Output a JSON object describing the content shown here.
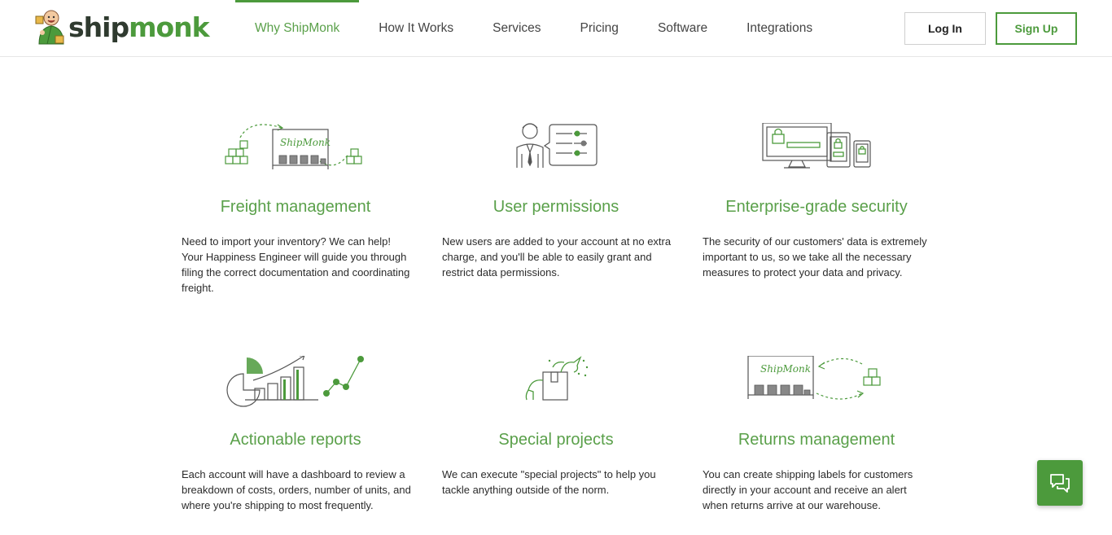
{
  "brand": {
    "name_part1": "ship",
    "name_part2": "monk",
    "accent_color": "#4c9a3c",
    "text_color": "#2f3a2f"
  },
  "nav": {
    "items": [
      {
        "label": "Why ShipMonk",
        "active": true
      },
      {
        "label": "How It Works",
        "active": false
      },
      {
        "label": "Services",
        "active": false
      },
      {
        "label": "Pricing",
        "active": false
      },
      {
        "label": "Software",
        "active": false
      },
      {
        "label": "Integrations",
        "active": false
      }
    ]
  },
  "auth": {
    "login_label": "Log In",
    "signup_label": "Sign Up"
  },
  "features": [
    {
      "icon": "freight-icon",
      "title": "Freight management",
      "description": "Need to import your inventory? We can help! Your Happiness Engineer will guide you through filing the correct documentation and coordinating freight."
    },
    {
      "icon": "user-permissions-icon",
      "title": "User permissions",
      "description": "New users are added to your account at no extra charge, and you'll be able to easily grant and restrict data permissions."
    },
    {
      "icon": "security-icon",
      "title": "Enterprise-grade security",
      "description": "The security of our customers' data is extremely important to us, so we take all the necessary measures to protect your data and privacy."
    },
    {
      "icon": "reports-icon",
      "title": "Actionable reports",
      "description": "Each account will have a dashboard to review a breakdown of costs, orders, number of units, and where you're shipping to most frequently."
    },
    {
      "icon": "unicorn-box-icon",
      "title": "Special projects",
      "description": "We can execute \"special projects\" to help you tackle anything outside of the norm."
    },
    {
      "icon": "returns-icon",
      "title": "Returns management",
      "description": "You can create shipping labels for customers directly in your account and receive an alert when returns arrive at our warehouse."
    }
  ],
  "warehouse_sign": "ShipMonk",
  "chat": {
    "icon": "chat-icon"
  }
}
